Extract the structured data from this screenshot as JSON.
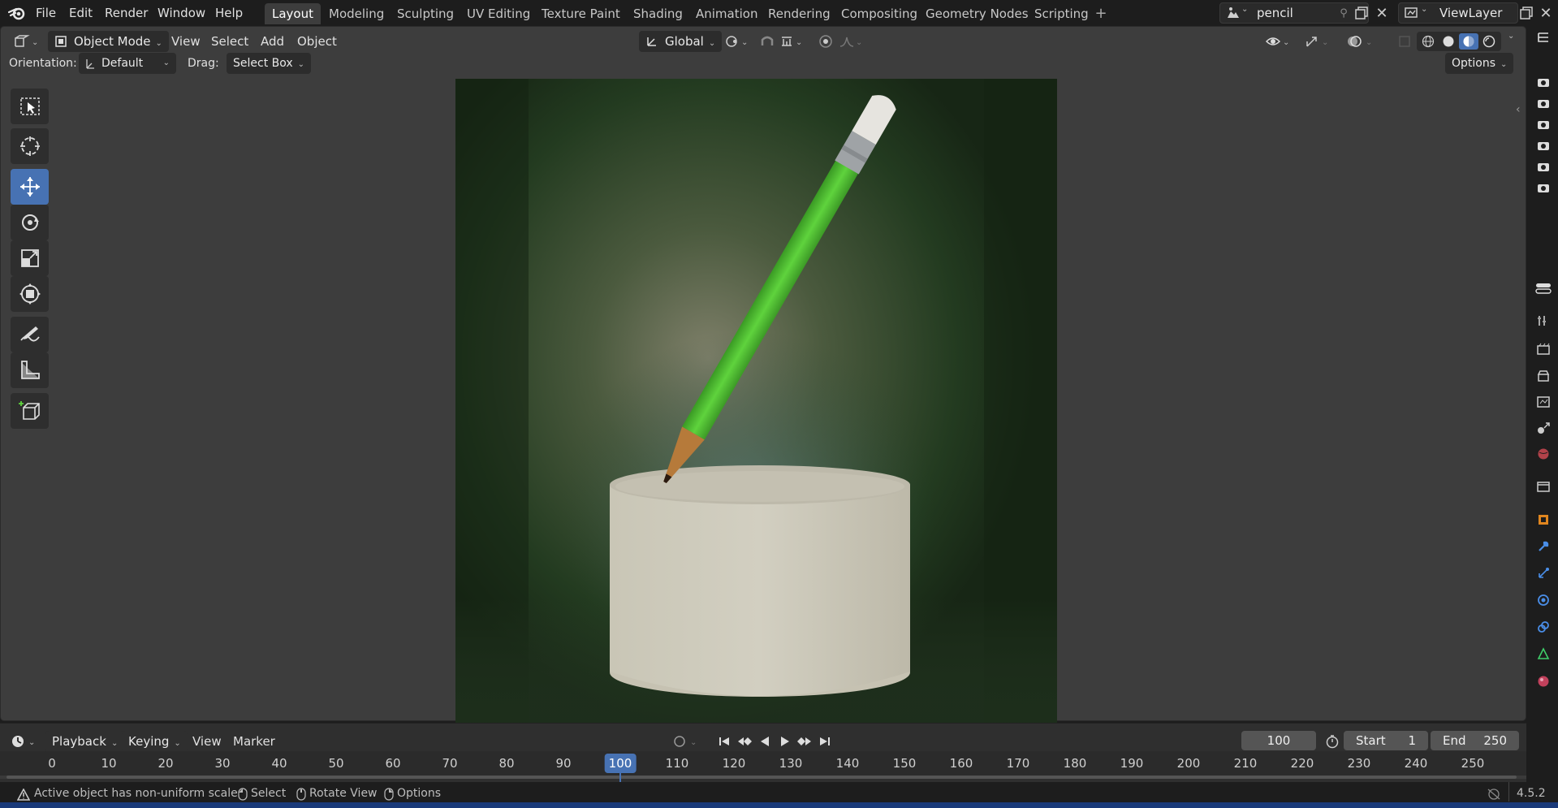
{
  "menu": {
    "items": [
      "File",
      "Edit",
      "Render",
      "Window",
      "Help"
    ]
  },
  "workspaces": {
    "tabs": [
      "Layout",
      "Modeling",
      "Sculpting",
      "UV Editing",
      "Texture Paint",
      "Shading",
      "Animation",
      "Rendering",
      "Compositing",
      "Geometry Nodes",
      "Scripting"
    ],
    "active": "Layout"
  },
  "scene": {
    "name": "pencil"
  },
  "view_layer": {
    "name": "ViewLayer"
  },
  "viewport_header": {
    "mode": "Object Mode",
    "menus": [
      "View",
      "Select",
      "Add",
      "Object"
    ],
    "transform_orientation": "Global",
    "options_label": "Options"
  },
  "tool_settings": {
    "orientation_label": "Orientation:",
    "orientation_value": "Default",
    "drag_label": "Drag:",
    "drag_value": "Select Box"
  },
  "toolbar": {
    "tools": [
      "select-box-icon",
      "cursor-icon",
      "move-icon",
      "rotate-icon",
      "scale-icon",
      "transform-icon",
      "annotate-icon",
      "measure-icon",
      "add-cube-icon"
    ],
    "active_tool": "move-icon"
  },
  "timeline": {
    "menus": [
      "Playback",
      "Keying",
      "View",
      "Marker"
    ],
    "current_frame": "100",
    "start_label": "Start",
    "start_value": "1",
    "end_label": "End",
    "end_value": "250",
    "ticks": [
      "0",
      "10",
      "20",
      "30",
      "40",
      "50",
      "60",
      "70",
      "80",
      "90",
      "100",
      "110",
      "120",
      "130",
      "140",
      "150",
      "160",
      "170",
      "180",
      "190",
      "200",
      "210",
      "220",
      "230",
      "240",
      "250"
    ]
  },
  "status": {
    "warning": "Active object has non-uniform scale",
    "select": "Select",
    "rotate_view": "Rotate View",
    "options": "Options",
    "version": "4.5.2"
  },
  "colors": {
    "accent": "#4772b3",
    "pencil_body": "#4fc133",
    "pencil_ferrule": "#9fa3a6",
    "pencil_eraser": "#e6e4df",
    "pencil_wood": "#b67a3a",
    "cup": "#cfcbbd"
  }
}
